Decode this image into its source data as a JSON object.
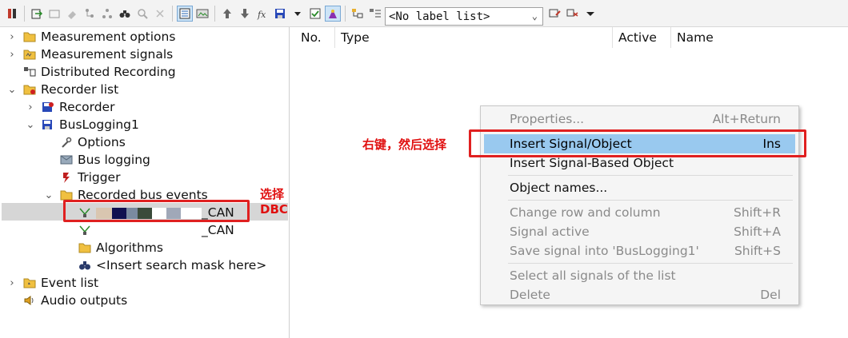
{
  "toolbar": {
    "label_list_value": "<No label list>",
    "buttons": [
      "record-icon",
      "import-icon",
      "export-icon",
      "eraser-icon",
      "tree-icon",
      "binoculars-icon",
      "magnifier-icon",
      "delete-icon",
      "view-icon",
      "image-icon",
      "up-arrow-icon",
      "down-arrow-icon",
      "function-icon",
      "save-icon",
      "dropdown-icon",
      "checkbox-icon",
      "wizard-icon",
      "tree-add-icon",
      "list-icon",
      "rename-icon",
      "cut-icon",
      "menu-dropdown-icon"
    ]
  },
  "tree": {
    "items": [
      {
        "label": "Measurement options",
        "arrow": "›",
        "icon": "folder-icon"
      },
      {
        "label": "Measurement signals",
        "arrow": "›",
        "icon": "signals-folder-icon"
      },
      {
        "label": "Distributed Recording",
        "arrow": "",
        "icon": "distributed-icon"
      },
      {
        "label": "Recorder list",
        "arrow": "⌄",
        "icon": "recorder-folder-icon"
      },
      {
        "label": "Recorder",
        "arrow": "›",
        "icon": "recorder-icon"
      },
      {
        "label": "BusLogging1",
        "arrow": "⌄",
        "icon": "disk-icon"
      },
      {
        "label": "Options",
        "arrow": "",
        "icon": "wrench-icon"
      },
      {
        "label": "Bus logging",
        "arrow": "",
        "icon": "envelope-icon"
      },
      {
        "label": "Trigger",
        "arrow": "",
        "icon": "trigger-icon"
      },
      {
        "label": "Recorded bus events",
        "arrow": "⌄",
        "icon": "folder-icon"
      },
      {
        "label": "_CAN",
        "arrow": "",
        "icon": "network-icon"
      },
      {
        "label": "_CAN",
        "arrow": "",
        "icon": "network-icon"
      },
      {
        "label": "Algorithms",
        "arrow": "",
        "icon": "folder-icon"
      },
      {
        "label": "<Insert search mask here>",
        "arrow": "",
        "icon": "binoculars-icon"
      },
      {
        "label": "Event list",
        "arrow": "›",
        "icon": "event-folder-icon"
      },
      {
        "label": "Audio outputs",
        "arrow": "",
        "icon": "speaker-icon"
      }
    ]
  },
  "annotations": {
    "select_dbc": "选择DBC",
    "right_click": "右键，然后选择"
  },
  "right_panel": {
    "columns": [
      "No.",
      "Type",
      "Active",
      "Name"
    ]
  },
  "context_menu": {
    "items": [
      {
        "label": "Properties...",
        "shortcut": "Alt+Return",
        "disabled": true
      },
      {
        "label": "Insert Signal/Object",
        "shortcut": "Ins",
        "disabled": false,
        "highlighted": true
      },
      {
        "label": "Insert Signal-Based Object",
        "shortcut": "",
        "disabled": false
      },
      {
        "label": "Object names...",
        "shortcut": "",
        "disabled": false
      },
      {
        "label": "Change row and column",
        "shortcut": "Shift+R",
        "disabled": true
      },
      {
        "label": "Signal active",
        "shortcut": "Shift+A",
        "disabled": true
      },
      {
        "label": "Save signal into 'BusLogging1'",
        "shortcut": "Shift+S",
        "disabled": true
      },
      {
        "label": "Select all signals of the list",
        "shortcut": "",
        "disabled": true
      },
      {
        "label": "Delete",
        "shortcut": "Del",
        "disabled": true
      }
    ]
  },
  "colors": {
    "highlight": "#99c9ef",
    "annotation_red": "#e02020",
    "selected_row": "#d6d6d6"
  }
}
